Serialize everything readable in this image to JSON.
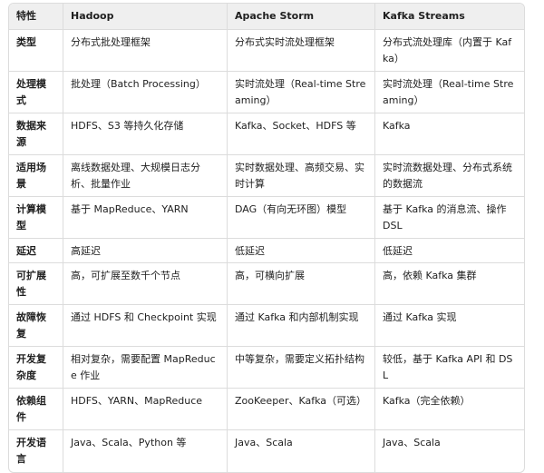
{
  "table": {
    "headers": [
      "特性",
      "Hadoop",
      "Apache Storm",
      "Kafka Streams"
    ],
    "rows": [
      [
        "类型",
        "分布式批处理框架",
        "分布式实时流处理框架",
        "分布式流处理库（内置于 Kafka）"
      ],
      [
        "处理模式",
        "批处理（Batch Processing）",
        "实时流处理（Real-time Streaming）",
        "实时流处理（Real-time Streaming）"
      ],
      [
        "数据来源",
        "HDFS、S3 等持久化存储",
        "Kafka、Socket、HDFS 等",
        "Kafka"
      ],
      [
        "适用场景",
        "离线数据处理、大规模日志分析、批量作业",
        "实时数据处理、高频交易、实时计算",
        "实时流数据处理、分布式系统的数据流"
      ],
      [
        "计算模型",
        "基于 MapReduce、YARN",
        "DAG（有向无环图）模型",
        "基于 Kafka 的消息流、操作 DSL"
      ],
      [
        "延迟",
        "高延迟",
        "低延迟",
        "低延迟"
      ],
      [
        "可扩展性",
        "高，可扩展至数千个节点",
        "高，可横向扩展",
        "高，依赖 Kafka 集群"
      ],
      [
        "故障恢复",
        "通过 HDFS 和 Checkpoint 实现",
        "通过 Kafka 和内部机制实现",
        "通过 Kafka 实现"
      ],
      [
        "开发复杂度",
        "相对复杂，需要配置 MapReduce 作业",
        "中等复杂，需要定义拓扑结构",
        "较低，基于 Kafka API 和 DSL"
      ],
      [
        "依赖组件",
        "HDFS、YARN、MapReduce",
        "ZooKeeper、Kafka（可选）",
        "Kafka（完全依赖）"
      ],
      [
        "开发语言",
        "Java、Scala、Python 等",
        "Java、Scala",
        "Java、Scala"
      ]
    ]
  }
}
